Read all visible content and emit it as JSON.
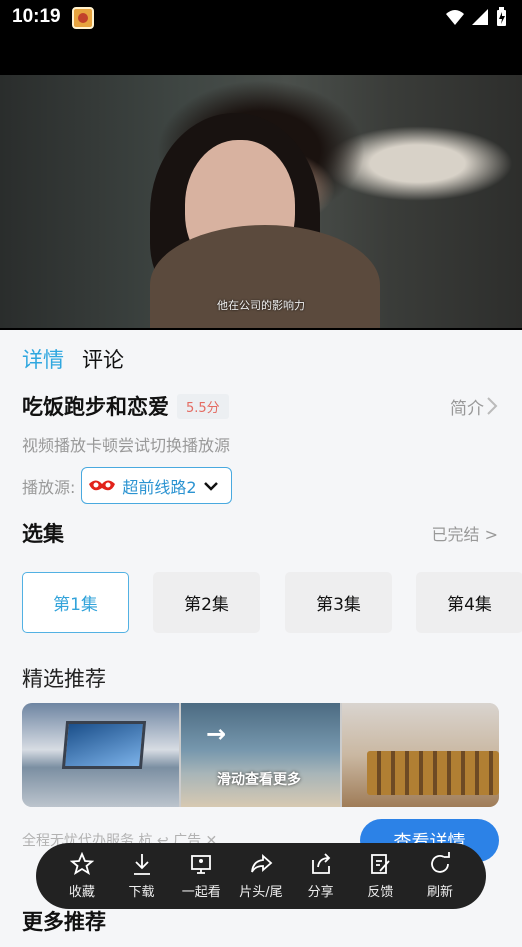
{
  "status_bar": {
    "time": "10:19",
    "app_icon": "cookie-app-icon",
    "wifi_icon": "wifi-icon",
    "signal_icon": "signal-icon",
    "battery_icon": "battery-charging-icon"
  },
  "player": {
    "subtitle": "他在公司的影响力"
  },
  "tabs": [
    {
      "label": "详情",
      "active": true
    },
    {
      "label": "评论",
      "active": false
    }
  ],
  "video": {
    "title": "吃饭跑步和恋爱",
    "score": "5.5分",
    "intro_label": "简介",
    "hint": "视频播放卡顿尝试切换播放源",
    "source_label": "播放源:",
    "source_value": "超前线路2"
  },
  "episodes": {
    "title": "选集",
    "status": "已完结 >",
    "items": [
      "第1集",
      "第2集",
      "第3集",
      "第4集"
    ]
  },
  "recommend": {
    "title": "精选推荐",
    "banner_text": "滑动查看更多"
  },
  "ad": {
    "text": "全程无忧代办服务   杭   ↩ 广告   ✕",
    "button": "查看详情"
  },
  "toolbar": [
    {
      "icon": "star-icon",
      "label": "收藏"
    },
    {
      "icon": "download-icon",
      "label": "下载"
    },
    {
      "icon": "watch-together-icon",
      "label": "一起看"
    },
    {
      "icon": "share-arrow-icon",
      "label": "片头/尾"
    },
    {
      "icon": "share-icon",
      "label": "分享"
    },
    {
      "icon": "feedback-icon",
      "label": "反馈"
    },
    {
      "icon": "refresh-icon",
      "label": "刷新"
    }
  ],
  "more_recommend": {
    "title": "更多推荐"
  },
  "colors": {
    "accent": "#2fa7df",
    "score": "#e46b62",
    "button": "#2c82e7"
  }
}
